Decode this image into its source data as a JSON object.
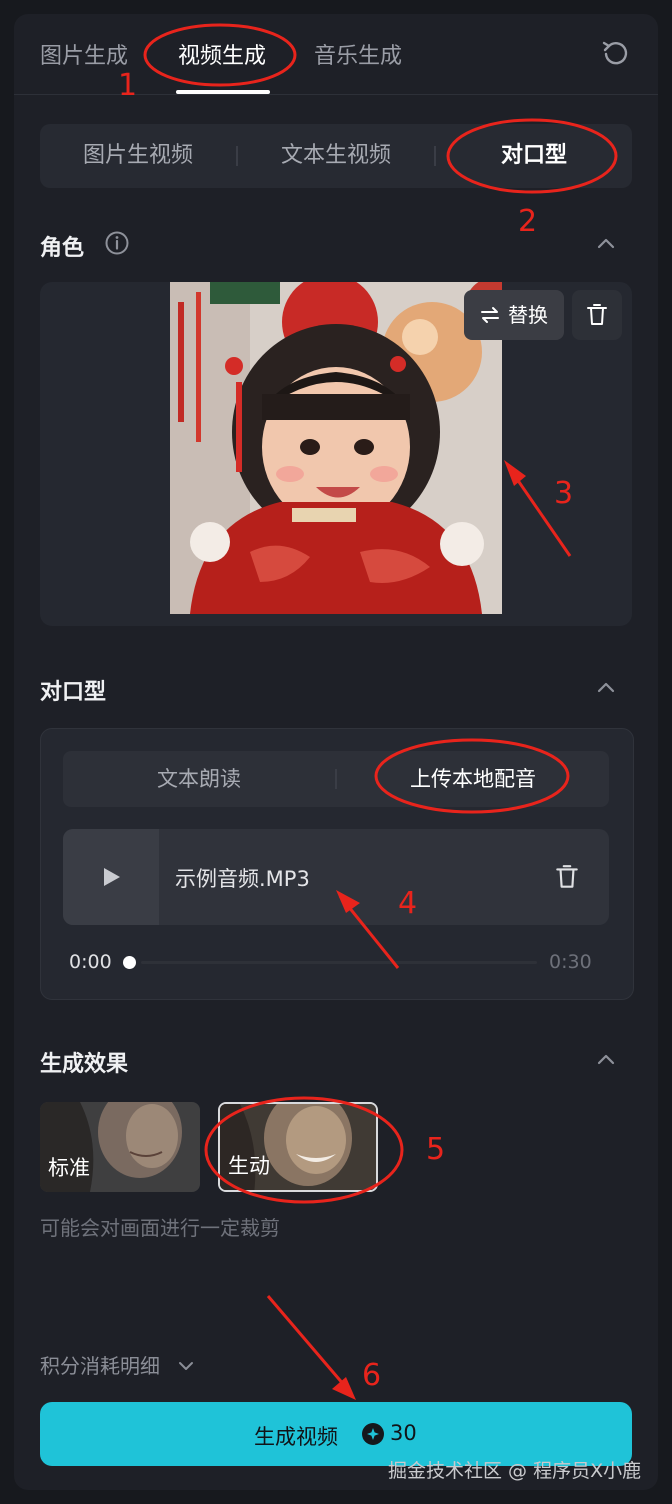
{
  "tabs": {
    "image": "图片生成",
    "video": "视频生成",
    "music": "音乐生成"
  },
  "modes": {
    "image_to_video": "图片生视频",
    "text_to_video": "文本生视频",
    "lip_sync": "对口型"
  },
  "role": {
    "title": "角色",
    "replace_label": "替换"
  },
  "lip_section": {
    "title": "对口型",
    "text_read": "文本朗读",
    "upload_audio": "上传本地配音",
    "file_name": "示例音频.MP3",
    "current_time": "0:00",
    "total_time": "0:30",
    "progress": 0
  },
  "effects": {
    "title": "生成效果",
    "standard": "标准",
    "vivid": "生动",
    "hint": "可能会对画面进行一定裁剪"
  },
  "footer": {
    "points_detail": "积分消耗明细",
    "generate_label": "生成视频",
    "cost": "30"
  },
  "annotations": [
    "1",
    "2",
    "3",
    "4",
    "5",
    "6"
  ],
  "watermark": "掘金技术社区 @ 程序员X小鹿",
  "colors": {
    "accent": "#1fc3d8",
    "annotation": "#e8241c"
  }
}
